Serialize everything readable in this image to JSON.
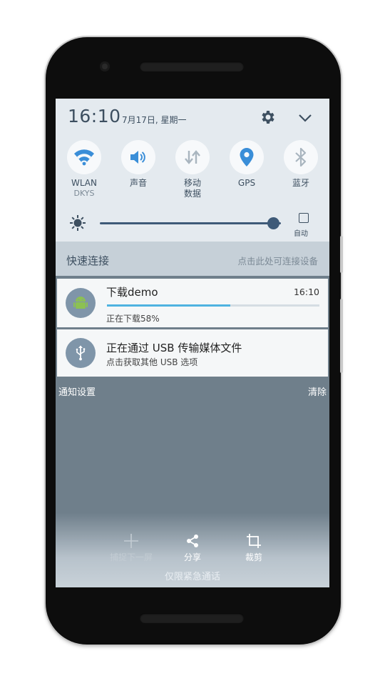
{
  "status": {
    "time": "16:10",
    "date": "7月17日, 星期一"
  },
  "quick_tiles": [
    {
      "label": "WLAN",
      "sub": "DKYS",
      "icon": "wifi-icon"
    },
    {
      "label": "声音",
      "sub": "",
      "icon": "volume-icon"
    },
    {
      "label": "移动",
      "sub": "数据",
      "icon": "mobile-data-icon"
    },
    {
      "label": "GPS",
      "sub": "",
      "icon": "location-icon"
    },
    {
      "label": "蓝牙",
      "sub": "",
      "icon": "bluetooth-icon"
    }
  ],
  "brightness": {
    "level": 0.96,
    "auto_label": "自动"
  },
  "quick_connect": {
    "title": "快速连接",
    "hint": "点击此处可连接设备"
  },
  "notifications": [
    {
      "title": "下载demo",
      "time": "16:10",
      "progress": 0.58,
      "sub": "正在下载58%",
      "icon": "android-icon"
    },
    {
      "title": "正在通过 USB 传输媒体文件",
      "sub": "点击获取其他 USB 选项",
      "icon": "usb-icon"
    }
  ],
  "footer": {
    "settings": "通知设置",
    "clear": "清除"
  },
  "bottom_actions": [
    {
      "label": "捕捉下一屏",
      "icon": "plus-icon",
      "enabled": false
    },
    {
      "label": "分享",
      "icon": "share-icon",
      "enabled": true
    },
    {
      "label": "裁剪",
      "icon": "crop-icon",
      "enabled": true
    }
  ],
  "emergency_text": "仅限紧急通话",
  "colors": {
    "accent": "#3a8ed8",
    "panel": "#e4eaef",
    "shade": "#6f7f8b",
    "progress": "#4fb3e0"
  }
}
